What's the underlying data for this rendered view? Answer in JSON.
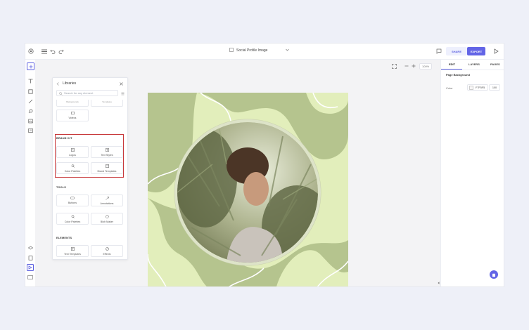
{
  "header": {
    "title": "Social Profile Image",
    "share_label": "SHARE",
    "export_label": "EXPORT"
  },
  "canvas": {
    "zoom": "100%"
  },
  "library": {
    "title": "Libraries",
    "search_placeholder": "Search for any element",
    "top_cards": [
      "Backgrounds",
      "Templates"
    ],
    "videos_label": "Videos",
    "brand_kit": {
      "heading": "BRAND KIT",
      "items": [
        "Logos",
        "Text Styles",
        "Color Palettes",
        "Brand Templates"
      ]
    },
    "tools": {
      "heading": "TOOLS",
      "items": [
        "Buttons",
        "Annotations",
        "Color Palettes",
        "Blob Maker"
      ]
    },
    "elements": {
      "heading": "ELEMENTS",
      "items": [
        "Text Templates",
        "Effects"
      ]
    }
  },
  "inspector": {
    "tabs": [
      "EDIT",
      "LAYERS",
      "PAGES"
    ],
    "section_title": "Page Background",
    "color_label": "Color",
    "color_hex": "F7F5F5",
    "opacity": "100"
  },
  "colors": {
    "accent": "#6264e6",
    "highlight": "#c8383a",
    "canvas_green": "#b5c48e",
    "light_green": "#e2eebb"
  }
}
